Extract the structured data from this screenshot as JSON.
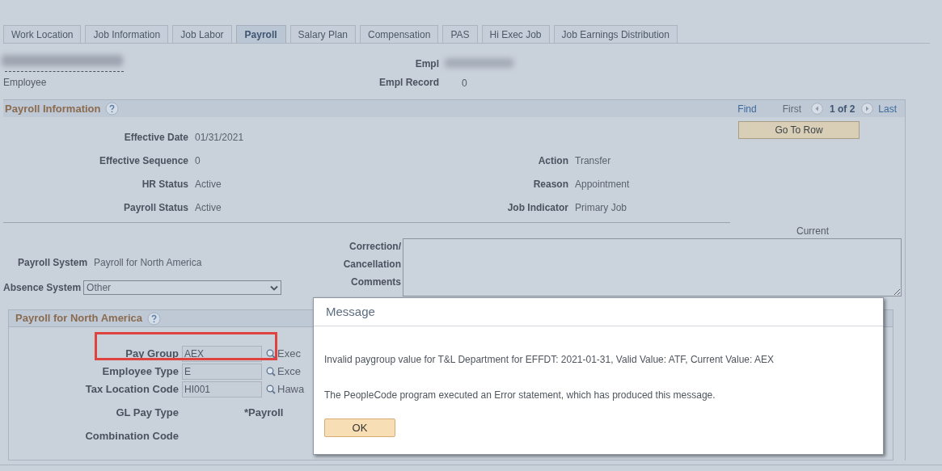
{
  "tabs": [
    {
      "label": "Work Location",
      "selected": false
    },
    {
      "label": "Job Information",
      "selected": false
    },
    {
      "label": "Job Labor",
      "selected": false
    },
    {
      "label": "Payroll",
      "selected": true
    },
    {
      "label": "Salary Plan",
      "selected": false
    },
    {
      "label": "Compensation",
      "selected": false
    },
    {
      "label": "PAS",
      "selected": false
    },
    {
      "label": "Hi Exec Job",
      "selected": false
    },
    {
      "label": "Job Earnings Distribution",
      "selected": false
    }
  ],
  "header": {
    "employee_label": "Employee",
    "empl_label": "Empl",
    "empl_record_label": "Empl Record",
    "empl_record_value": "0"
  },
  "payroll_information": {
    "title": "Payroll Information",
    "nav": {
      "find": "Find",
      "first": "First",
      "position": "1 of 2",
      "last": "Last"
    },
    "go_to_row": "Go To Row",
    "left_fields": [
      {
        "label": "Effective Date",
        "value": "01/31/2021"
      },
      {
        "label": "Effective Sequence",
        "value": "0"
      },
      {
        "label": "HR Status",
        "value": "Active"
      },
      {
        "label": "Payroll Status",
        "value": "Active"
      }
    ],
    "right_fields": [
      {
        "label": "Action",
        "value": "Transfer"
      },
      {
        "label": "Reason",
        "value": "Appointment"
      },
      {
        "label": "Job Indicator",
        "value": "Primary Job"
      }
    ],
    "current_label": "Current",
    "payroll_system": {
      "label": "Payroll System",
      "value": "Payroll for North America"
    },
    "absence_system": {
      "label": "Absence System",
      "value": "Other"
    },
    "comments_label": "Correction/ Cancellation Comments"
  },
  "north_america": {
    "title": "Payroll for North America",
    "fields": [
      {
        "label": "Pay Group",
        "value": "AEX",
        "description": "Exec",
        "highlighted": true
      },
      {
        "label": "Employee Type",
        "value": "E",
        "description": "Exce",
        "highlighted": false
      },
      {
        "label": "Tax Location Code",
        "value": "HI001",
        "description": "Hawa",
        "highlighted": false
      }
    ],
    "gl_pay_type_label": "GL Pay Type",
    "payroll_label": "*Payroll",
    "combination_code_label": "Combination Code"
  },
  "message_dialog": {
    "title": "Message",
    "lines": [
      "Invalid paygroup value for T&L Department for EFFDT: 2021-01-31, Valid Value: ATF, Current Value: AEX",
      "The PeopleCode program executed an Error statement, which has produced this message."
    ],
    "ok": "OK"
  }
}
